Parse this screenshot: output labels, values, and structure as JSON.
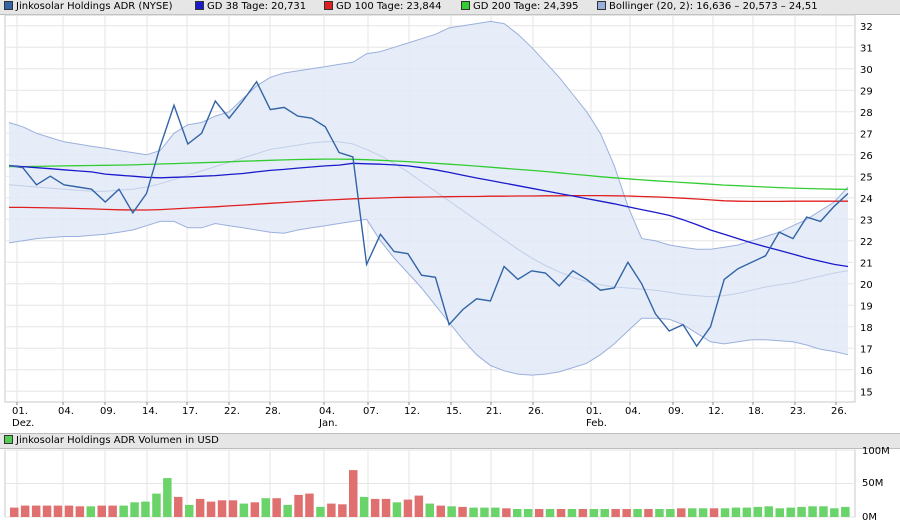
{
  "legend": {
    "items": [
      {
        "label": "Jinkosolar Holdings ADR (NYSE)",
        "color": "#3264a6"
      },
      {
        "label": "GD 38 Tage: 20,731",
        "color": "#1a1acc"
      },
      {
        "label": "GD 100 Tage: 23,844",
        "color": "#e02020"
      },
      {
        "label": "GD 200 Tage: 24,395",
        "color": "#33cc33"
      },
      {
        "label": "Bollinger (20, 2): 16,636 – 20,573 – 24,51",
        "color": "#9ab0dc"
      }
    ],
    "volume_label": "Jinkosolar Holdings ADR Volumen in USD",
    "volume_color": "#55cc55"
  },
  "chart_data": [
    {
      "type": "line",
      "ylim": [
        14.5,
        32.5
      ],
      "y_ticks": [
        15,
        16,
        17,
        18,
        19,
        20,
        21,
        22,
        23,
        24,
        25,
        26,
        27,
        28,
        29,
        30,
        31,
        32
      ],
      "x_tick_labels": [
        "01.",
        "04.",
        "09.",
        "14.",
        "17.",
        "22.",
        "28.",
        "04.",
        "07.",
        "12.",
        "15.",
        "21.",
        "26.",
        "01.",
        "04.",
        "09.",
        "12.",
        "18.",
        "23.",
        "26."
      ],
      "x_month_labels": [
        {
          "tick": 0,
          "label": "Dez."
        },
        {
          "tick": 7,
          "label": "Jan."
        },
        {
          "tick": 13,
          "label": "Feb."
        }
      ],
      "grid": true,
      "series": [
        {
          "name": "Jinkosolar Holdings ADR (NYSE)",
          "color": "#3264a6",
          "values": [
            25.5,
            25.4,
            24.6,
            25.0,
            24.6,
            24.5,
            24.4,
            23.8,
            24.4,
            23.3,
            24.2,
            26.4,
            28.3,
            26.5,
            27.0,
            28.5,
            27.7,
            28.5,
            29.4,
            28.1,
            28.2,
            27.8,
            27.7,
            27.3,
            26.1,
            25.9,
            20.9,
            22.3,
            21.5,
            21.4,
            20.4,
            20.3,
            18.1,
            18.8,
            19.3,
            19.2,
            20.8,
            20.2,
            20.6,
            20.5,
            19.9,
            20.6,
            20.2,
            19.7,
            19.8,
            21.0,
            20.0,
            18.6,
            17.8,
            18.1,
            17.1,
            18.0,
            20.2,
            20.7,
            21.0,
            21.3,
            22.4,
            22.1,
            23.1,
            22.9,
            23.6,
            24.2
          ]
        },
        {
          "name": "GD 38 Tage: 20,731",
          "color": "#1a1acc",
          "values": [
            25.5,
            25.45,
            25.4,
            25.35,
            25.3,
            25.25,
            25.2,
            25.1,
            25.05,
            25.0,
            24.95,
            24.93,
            24.95,
            24.97,
            25.0,
            25.03,
            25.08,
            25.13,
            25.2,
            25.27,
            25.32,
            25.38,
            25.43,
            25.48,
            25.52,
            25.6,
            25.58,
            25.56,
            25.53,
            25.48,
            25.4,
            25.3,
            25.18,
            25.05,
            24.92,
            24.8,
            24.68,
            24.56,
            24.44,
            24.32,
            24.2,
            24.08,
            23.96,
            23.84,
            23.72,
            23.58,
            23.45,
            23.32,
            23.18,
            22.98,
            22.75,
            22.5,
            22.3,
            22.1,
            21.9,
            21.72,
            21.55,
            21.38,
            21.2,
            21.05,
            20.9,
            20.8,
            20.73
          ]
        },
        {
          "name": "GD 100 Tage: 23,844",
          "color": "#e02020",
          "values": [
            23.55,
            23.55,
            23.54,
            23.53,
            23.52,
            23.5,
            23.48,
            23.46,
            23.44,
            23.43,
            23.43,
            23.45,
            23.48,
            23.52,
            23.55,
            23.58,
            23.62,
            23.66,
            23.7,
            23.74,
            23.78,
            23.82,
            23.86,
            23.89,
            23.92,
            23.95,
            23.97,
            23.99,
            24.01,
            24.02,
            24.03,
            24.04,
            24.05,
            24.06,
            24.06,
            24.07,
            24.07,
            24.08,
            24.08,
            24.09,
            24.09,
            24.1,
            24.1,
            24.1,
            24.09,
            24.08,
            24.06,
            24.04,
            24.01,
            23.98,
            23.94,
            23.9,
            23.86,
            23.84,
            23.83,
            23.83,
            23.83,
            23.84,
            23.84,
            23.84,
            23.84,
            23.84
          ]
        },
        {
          "name": "GD 200 Tage: 24,395",
          "color": "#33cc33",
          "values": [
            25.45,
            25.45,
            25.46,
            25.47,
            25.48,
            25.49,
            25.5,
            25.51,
            25.52,
            25.53,
            25.55,
            25.57,
            25.59,
            25.61,
            25.63,
            25.65,
            25.67,
            25.7,
            25.72,
            25.74,
            25.76,
            25.78,
            25.79,
            25.8,
            25.8,
            25.79,
            25.77,
            25.74,
            25.71,
            25.68,
            25.64,
            25.6,
            25.56,
            25.52,
            25.47,
            25.42,
            25.37,
            25.32,
            25.27,
            25.22,
            25.16,
            25.1,
            25.04,
            24.98,
            24.93,
            24.88,
            24.83,
            24.79,
            24.75,
            24.71,
            24.67,
            24.63,
            24.59,
            24.56,
            24.53,
            24.5,
            24.47,
            24.45,
            24.43,
            24.41,
            24.4,
            24.39
          ]
        },
        {
          "name": "Bollinger upper",
          "color": "#9ab0dc",
          "values": [
            27.5,
            27.3,
            27.0,
            26.8,
            26.6,
            26.5,
            26.4,
            26.3,
            26.2,
            26.1,
            26.0,
            26.2,
            27.0,
            27.4,
            27.5,
            27.8,
            28.0,
            28.6,
            29.2,
            29.6,
            29.8,
            29.9,
            30.0,
            30.1,
            30.2,
            30.3,
            30.7,
            30.8,
            31.0,
            31.2,
            31.4,
            31.6,
            31.9,
            32.0,
            32.1,
            32.2,
            32.1,
            31.6,
            31.0,
            30.3,
            29.6,
            28.8,
            28.0,
            27.0,
            25.5,
            23.6,
            22.1,
            22.0,
            21.8,
            21.7,
            21.6,
            21.6,
            21.7,
            21.8,
            22.0,
            22.2,
            22.4,
            22.7,
            23.0,
            23.4,
            23.8,
            24.5
          ]
        },
        {
          "name": "Bollinger middle",
          "color": "#c2cfe8",
          "values": [
            24.6,
            24.55,
            24.5,
            24.45,
            24.4,
            24.35,
            24.3,
            24.3,
            24.35,
            24.4,
            24.5,
            24.65,
            24.85,
            25.05,
            25.25,
            25.45,
            25.65,
            25.85,
            26.05,
            26.25,
            26.35,
            26.45,
            26.55,
            26.6,
            26.6,
            26.5,
            26.25,
            25.95,
            25.6,
            25.2,
            24.75,
            24.3,
            23.85,
            23.4,
            22.95,
            22.5,
            22.05,
            21.6,
            21.2,
            20.85,
            20.55,
            20.3,
            20.1,
            19.95,
            19.85,
            19.8,
            19.75,
            19.7,
            19.6,
            19.5,
            19.45,
            19.4,
            19.45,
            19.55,
            19.7,
            19.85,
            19.95,
            20.05,
            20.2,
            20.35,
            20.5,
            20.6
          ]
        },
        {
          "name": "Bollinger lower",
          "color": "#9ab0dc",
          "values": [
            21.9,
            22.0,
            22.1,
            22.15,
            22.2,
            22.2,
            22.25,
            22.3,
            22.4,
            22.5,
            22.7,
            22.9,
            22.9,
            22.6,
            22.6,
            22.8,
            22.7,
            22.6,
            22.5,
            22.4,
            22.35,
            22.5,
            22.6,
            22.7,
            22.8,
            22.9,
            23.0,
            22.0,
            21.2,
            20.5,
            19.8,
            19.0,
            18.2,
            17.4,
            16.7,
            16.2,
            15.95,
            15.8,
            15.75,
            15.8,
            15.9,
            16.1,
            16.3,
            16.7,
            17.2,
            17.8,
            18.4,
            18.4,
            18.35,
            18.1,
            17.7,
            17.3,
            17.2,
            17.3,
            17.4,
            17.4,
            17.35,
            17.3,
            17.15,
            16.95,
            16.85,
            16.7
          ]
        }
      ]
    },
    {
      "type": "bar",
      "name": "Jinkosolar Holdings ADR Volumen in USD",
      "ylim": [
        0,
        100
      ],
      "y_tick_labels": [
        "100M",
        "50M",
        "0M"
      ],
      "up_color": "#6ad46a",
      "down_color": "#e07070",
      "values": [
        14,
        17,
        17,
        17,
        17,
        17,
        16,
        16,
        17,
        17,
        17,
        22,
        23,
        35,
        58,
        30,
        18,
        27,
        23,
        25,
        25,
        20,
        22,
        28,
        28,
        18,
        33,
        35,
        15,
        20,
        19,
        70,
        30,
        27,
        27,
        22,
        26,
        32,
        20,
        17,
        16,
        15,
        14,
        14,
        14,
        13,
        12,
        12,
        12,
        12,
        12,
        12,
        12,
        12,
        12,
        12,
        12,
        12,
        12,
        12,
        12,
        13,
        13,
        13,
        13,
        13,
        14,
        14,
        15,
        16,
        13,
        14,
        15,
        16,
        16,
        13,
        15
      ],
      "colors": [
        "r",
        "r",
        "r",
        "r",
        "r",
        "r",
        "r",
        "g",
        "r",
        "r",
        "g",
        "g",
        "g",
        "g",
        "g",
        "r",
        "g",
        "r",
        "r",
        "r",
        "r",
        "g",
        "r",
        "g",
        "r",
        "g",
        "r",
        "r",
        "g",
        "r",
        "r",
        "r",
        "g",
        "r",
        "r",
        "g",
        "r",
        "r",
        "g",
        "r",
        "g",
        "r",
        "g",
        "g",
        "g",
        "r",
        "g",
        "g",
        "r",
        "g",
        "r",
        "g",
        "r",
        "g",
        "g",
        "r",
        "r",
        "g",
        "r",
        "g",
        "g",
        "r",
        "g",
        "g",
        "r",
        "g",
        "g",
        "g",
        "g",
        "g",
        "g",
        "g",
        "g",
        "g",
        "g",
        "g",
        "g"
      ]
    }
  ]
}
